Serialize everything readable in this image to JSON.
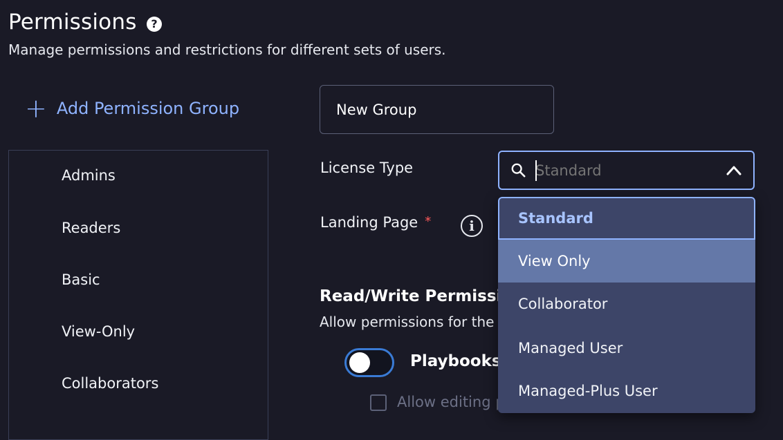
{
  "header": {
    "title": "Permissions",
    "help_icon": "question-circle-icon",
    "subtitle": "Manage permissions and restrictions for different sets of users."
  },
  "sidebar": {
    "add_group_label": "Add Permission Group",
    "add_icon": "plus-icon",
    "groups": [
      {
        "label": "Admins"
      },
      {
        "label": "Readers"
      },
      {
        "label": "Basic"
      },
      {
        "label": "View-Only"
      },
      {
        "label": "Collaborators"
      }
    ]
  },
  "form": {
    "group_name_value": "New Group",
    "license_type": {
      "label": "License Type",
      "placeholder": "Standard",
      "search_icon": "search-icon",
      "chevron_icon": "chevron-up-icon",
      "options": [
        {
          "label": "Standard",
          "state": "selected"
        },
        {
          "label": "View Only",
          "state": "hover"
        },
        {
          "label": "Collaborator",
          "state": "default"
        },
        {
          "label": "Managed User",
          "state": "default"
        },
        {
          "label": "Managed-Plus User",
          "state": "default"
        }
      ]
    },
    "landing_page": {
      "label": "Landing Page",
      "required_mark": "*",
      "info_icon": "info-circle-icon"
    },
    "read_write": {
      "title": "Read/Write Permissions",
      "description": "Allow permissions for the",
      "playbooks_label": "Playbooks",
      "playbooks_enabled": false,
      "allow_editing_label": "Allow editing playbooks",
      "allow_editing_checked": false
    }
  },
  "colors": {
    "background": "#1a1a26",
    "accent": "#8fb3ff",
    "dropdown_bg": "#3d4568",
    "hover_bg": "#6478a8",
    "required": "#ff5a5a"
  }
}
